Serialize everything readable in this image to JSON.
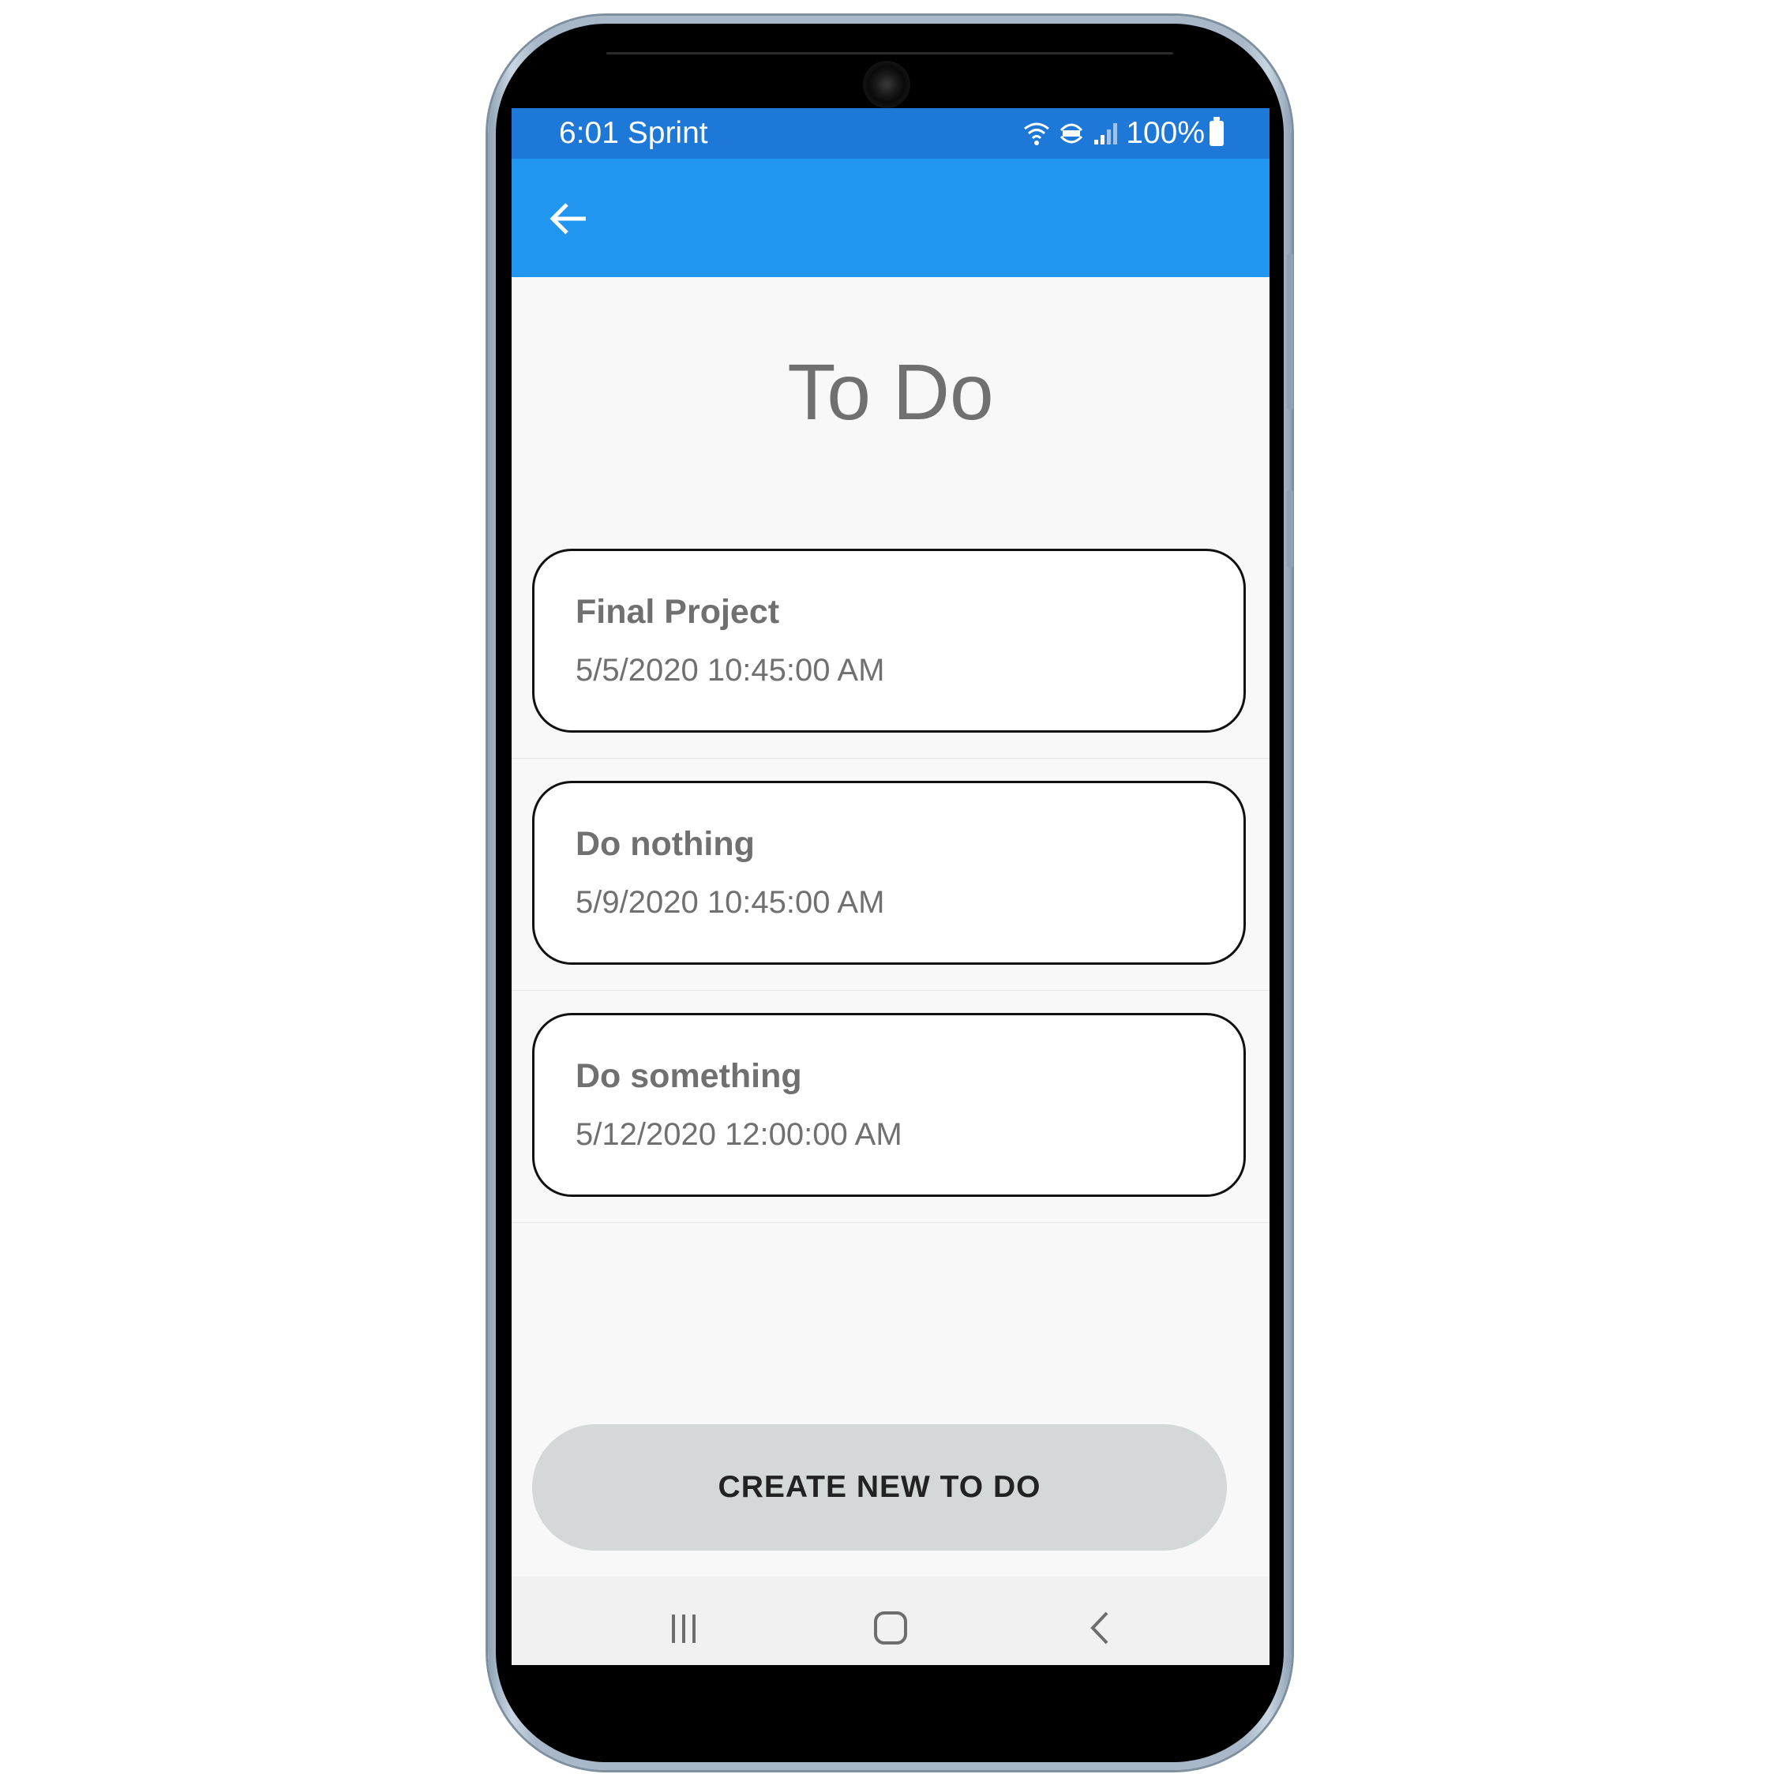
{
  "status_bar": {
    "time_carrier": "6:01 Sprint",
    "battery": "100%",
    "icons": [
      "wifi-icon",
      "volte-icon",
      "signal-icon",
      "battery-icon"
    ]
  },
  "app_bar": {
    "back_icon": "arrow-left-icon"
  },
  "page": {
    "title": "To Do"
  },
  "todos": [
    {
      "title": "Final Project",
      "date": "5/5/2020 10:45:00 AM"
    },
    {
      "title": "Do nothing",
      "date": "5/9/2020 10:45:00 AM"
    },
    {
      "title": "Do something",
      "date": "5/12/2020 12:00:00 AM"
    }
  ],
  "create_button": {
    "label": "CREATE NEW TO DO"
  },
  "nav_bar": {
    "icons": [
      "recent-apps-icon",
      "home-icon",
      "back-icon"
    ]
  },
  "colors": {
    "status_bar": "#1d78d8",
    "app_bar": "#2196f0",
    "background": "#f8f8f8",
    "button": "#d5d8d8",
    "text_gray": "#707070"
  }
}
